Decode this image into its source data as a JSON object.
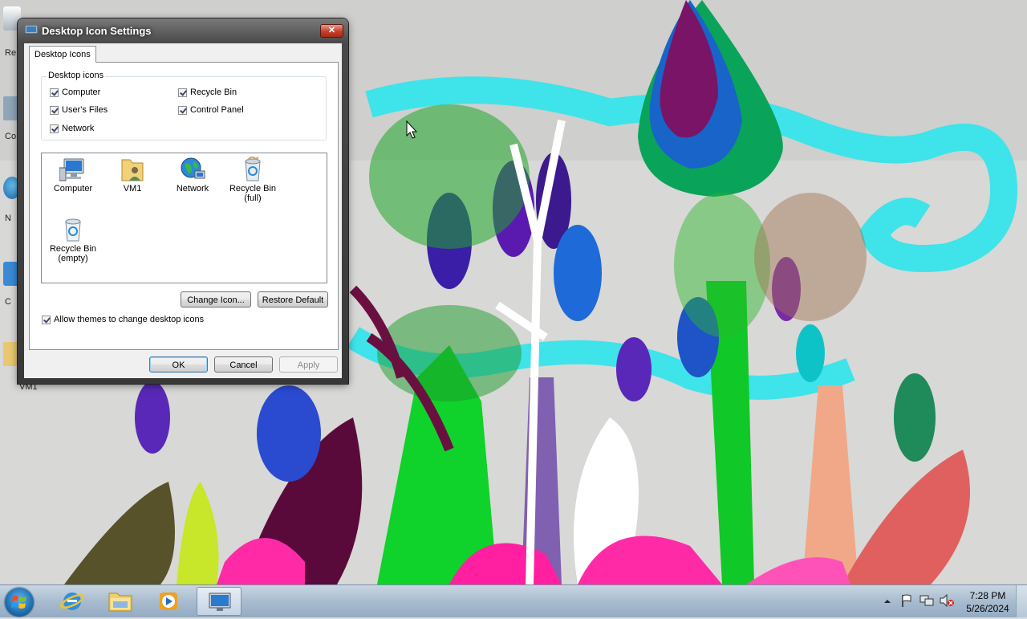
{
  "desktop": {
    "icon_labels": [
      "Re",
      "Co",
      "N",
      "C",
      "VM1"
    ]
  },
  "dialog": {
    "title": "Desktop Icon Settings",
    "close_label": "✕",
    "tab_label": "Desktop Icons",
    "group_label": "Desktop icons",
    "checkboxes": [
      {
        "label": "Computer",
        "checked": true
      },
      {
        "label": "Recycle Bin",
        "checked": true
      },
      {
        "label": "User's Files",
        "checked": true
      },
      {
        "label": "Control Panel",
        "checked": true
      },
      {
        "label": "Network",
        "checked": true
      }
    ],
    "icons": [
      {
        "label": "Computer",
        "icon": "computer-icon"
      },
      {
        "label": "VM1",
        "icon": "user-folder-icon"
      },
      {
        "label": "Network",
        "icon": "network-icon"
      },
      {
        "label": "Recycle Bin\n(full)",
        "icon": "recycle-bin-full-icon"
      },
      {
        "label": "Recycle Bin\n(empty)",
        "icon": "recycle-bin-empty-icon"
      }
    ],
    "change_icon_label": "Change Icon...",
    "restore_default_label": "Restore Default",
    "allow_themes_label": "Allow themes to change desktop icons",
    "allow_themes_checked": true,
    "ok_label": "OK",
    "cancel_label": "Cancel",
    "apply_label": "Apply"
  },
  "taskbar": {
    "items": [
      "start-orb-icon",
      "internet-explorer-icon",
      "windows-explorer-icon",
      "media-player-icon",
      "desktop-icon-settings-icon"
    ],
    "tray_icons": [
      "show-hidden-icons-icon",
      "action-center-flag-icon",
      "network-icon",
      "volume-muted-icon"
    ],
    "time": "7:28 PM",
    "date": "5/26/2024"
  },
  "colors": {
    "taskbar": "#a8bccf",
    "dialog_frame": "#4a4a4a",
    "client": "#f0f0f0",
    "close_button": "#c4402c"
  }
}
